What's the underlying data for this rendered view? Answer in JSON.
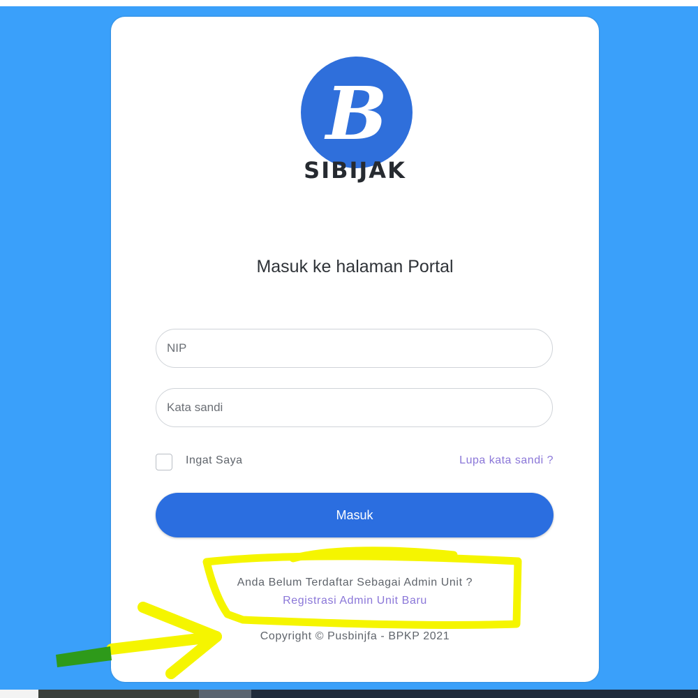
{
  "brand": {
    "logo_icon": "letter-b-logo-icon",
    "logo_letter": "B",
    "name": "SIBIJAK"
  },
  "login": {
    "heading": "Masuk ke halaman Portal",
    "nip_placeholder": "NIP",
    "password_placeholder": "Kata sandi",
    "remember_label": "Ingat Saya",
    "remember_checked": false,
    "forgot_link": "Lupa kata sandi ?",
    "submit_label": "Masuk"
  },
  "register": {
    "prompt": "Anda Belum Terdaftar Sebagai Admin Unit ?",
    "link": "Registrasi Admin Unit Baru"
  },
  "footer": {
    "copyright": "Copyright © Pusbinjfa - BPKP 2021"
  },
  "colors": {
    "background": "#3aa0fa",
    "primary": "#2b6ee0",
    "link": "#8a76d8",
    "highlight_annotation": "#f5f500",
    "arrow_annotation": "#2e9a1a"
  }
}
